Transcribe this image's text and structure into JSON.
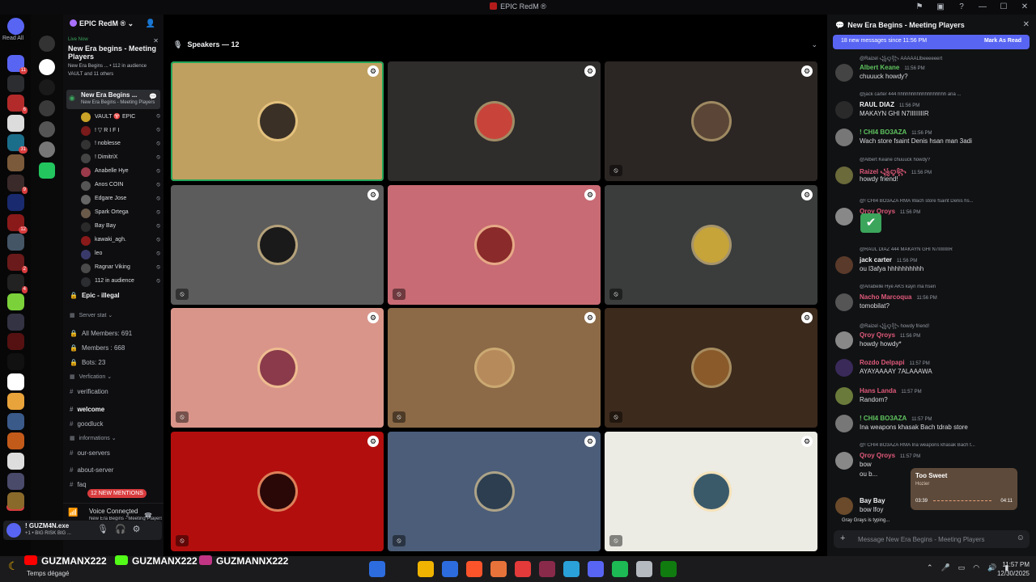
{
  "window": {
    "title": "EPIC RedM ®"
  },
  "rail": {
    "read_all": "Read All",
    "new_label": "NEW",
    "servers": [
      {
        "color": "#5865f2",
        "badge": "11"
      },
      {
        "color": "#2b2d31",
        "badge": ""
      },
      {
        "color": "#b32a2a",
        "badge": "6"
      },
      {
        "color": "#dcdcdc",
        "badge": ""
      },
      {
        "color": "#1b6e8a",
        "badge": "31"
      },
      {
        "color": "#7a5a3a",
        "badge": ""
      },
      {
        "color": "#3a2a2a",
        "badge": "9"
      },
      {
        "color": "#1a2a6e",
        "badge": ""
      },
      {
        "color": "#8a1a1a",
        "badge": "12"
      },
      {
        "color": "#445566",
        "badge": ""
      },
      {
        "color": "#6a1a1a",
        "badge": "2"
      },
      {
        "color": "#222",
        "badge": "4"
      },
      {
        "color": "#7bd13a",
        "badge": ""
      },
      {
        "color": "#333344",
        "badge": ""
      },
      {
        "color": "#551111",
        "badge": ""
      },
      {
        "color": "#111",
        "badge": ""
      },
      {
        "color": "#ffffff",
        "badge": ""
      },
      {
        "color": "#e8a33a",
        "badge": ""
      },
      {
        "color": "#3a5a8a",
        "badge": ""
      },
      {
        "color": "#c25a1a",
        "badge": ""
      },
      {
        "color": "#dddddd",
        "badge": ""
      },
      {
        "color": "#4a4a6a",
        "badge": ""
      },
      {
        "color": "#8a6a2a",
        "badge": ""
      }
    ]
  },
  "channels": {
    "server_name": "EPIC RedM ®",
    "live_now": {
      "label": "Live Now",
      "title": "New Era begins - Meeting Players",
      "sub": "New Era Begins ... • 112 in audience",
      "participants": "VAULT and 11 others"
    },
    "voice_channel": {
      "name": "New Era Begins ...",
      "sub": "New Era Begins - Meeting Players"
    },
    "voice_users": [
      {
        "name": "VAULT ♈ EPIC",
        "color": "#c9a227"
      },
      {
        "name": "! ▽ R I F I",
        "color": "#7a1a1a"
      },
      {
        "name": "! noblesse",
        "color": "#333"
      },
      {
        "name": "! DimitriX",
        "color": "#444"
      },
      {
        "name": "Anabelle Hye",
        "color": "#9a3a4a"
      },
      {
        "name": "Anos  COIN",
        "color": "#555"
      },
      {
        "name": "Edgare Jose",
        "color": "#666"
      },
      {
        "name": "Spark Ortega",
        "color": "#6a5a4a"
      },
      {
        "name": "Bay Bay",
        "color": "#2a2a2a"
      },
      {
        "name": "kawaki_agh.",
        "color": "#8a1a1a"
      },
      {
        "name": "leo",
        "color": "#3a3a6a"
      },
      {
        "name": "Ragnar Viking",
        "color": "#4a4a4a"
      },
      {
        "name": "112 in audience",
        "color": "#2b2d31"
      }
    ],
    "list": [
      {
        "name": "Epic - illegal",
        "hash": "🔒",
        "type": "bright"
      },
      {
        "name": "Server stat ⌄",
        "hash": "▦",
        "type": "cat"
      },
      {
        "name": "All Members: 691",
        "hash": "🔒",
        "type": ""
      },
      {
        "name": "Members : 668",
        "hash": "🔒",
        "type": ""
      },
      {
        "name": "Bots: 23",
        "hash": "🔒",
        "type": ""
      },
      {
        "name": "Verfication ⌄",
        "hash": "▦",
        "type": "cat"
      },
      {
        "name": "verification",
        "hash": "#",
        "type": ""
      },
      {
        "name": "welcome",
        "hash": "#",
        "type": "bright"
      },
      {
        "name": "goodluck",
        "hash": "#",
        "type": ""
      },
      {
        "name": "informations ⌄",
        "hash": "▦",
        "type": "cat"
      },
      {
        "name": "our-servers",
        "hash": "#",
        "type": ""
      },
      {
        "name": "about-server",
        "hash": "#",
        "type": ""
      },
      {
        "name": "faq",
        "hash": "#",
        "type": ""
      }
    ],
    "mentions": "12 NEW MENTIONS"
  },
  "voicebar": {
    "status": "Voice Connected",
    "channel": "New Era Begins - Meeting Players / EPIC..."
  },
  "user": {
    "name": "! GUZM4N.exe",
    "status": "+1 • BIG RISK BIG ..."
  },
  "stage": {
    "header": "Speakers — 12",
    "tiles": [
      {
        "bg": "#c0a060",
        "avatar": "#3a3026",
        "active": true,
        "muted": false
      },
      {
        "bg": "#2f2c2c",
        "avatar": "#c8443a",
        "active": false,
        "muted": false
      },
      {
        "bg": "#2b2624",
        "avatar": "#5a4536",
        "active": false,
        "muted": true
      },
      {
        "bg": "#5c5c5c",
        "avatar": "#1a1a1a",
        "active": false,
        "muted": true
      },
      {
        "bg": "#c86b74",
        "avatar": "#8a2a2a",
        "active": false,
        "muted": true
      },
      {
        "bg": "#3a3d3c",
        "avatar": "#c6a43a",
        "active": false,
        "muted": true
      },
      {
        "bg": "#d9958a",
        "avatar": "#8a3a4a",
        "active": false,
        "muted": true
      },
      {
        "bg": "#8c6a47",
        "avatar": "#b78a5c",
        "active": false,
        "muted": true
      },
      {
        "bg": "#3c2a1d",
        "avatar": "#8a5a2a",
        "active": false,
        "muted": true
      },
      {
        "bg": "#b30e0e",
        "avatar": "#2a0808",
        "active": false,
        "muted": true
      },
      {
        "bg": "#4b5d78",
        "avatar": "#2c3e50",
        "active": false,
        "muted": true
      },
      {
        "bg": "#ecebe4",
        "avatar": "#3a5a6a",
        "active": false,
        "muted": true
      }
    ]
  },
  "chat": {
    "title": "New Era Begins - Meeting Players",
    "unread": "18 new messages since 11:56 PM",
    "mark_read": "Mark As Read",
    "messages": [
      {
        "reply": "@Raizel ꧁ꨄ꧂ AAAAALlbeeeeeert",
        "name": "Albert Keane",
        "nc": "#5fc45f",
        "time": "11:56 PM",
        "text": "chuuuck howdy?",
        "ac": "#444"
      },
      {
        "reply": "@jack carter 444 hhhhhhhhhhhhhhhhhh ana ...",
        "name": "RAUL DIAZ",
        "nc": "#f2f3f5",
        "time": "11:56 PM",
        "text": "MAKAYN GHI N7IIIIIIIIR",
        "ac": "#2a2a2a"
      },
      {
        "reply": "",
        "name": "! CHI4 BO3AZA",
        "nc": "#5fc45f",
        "time": "11:56 PM",
        "text": "Wach store fsaint Denis hsan man 3adi",
        "ac": "#777"
      },
      {
        "reply": "@Albert Keane chuuuck howdy?",
        "name": "Raizel ꧁ꨄ꧂",
        "nc": "#e05a7a",
        "time": "11:56 PM",
        "text": "howdy friend!",
        "ac": "#6a6a3a"
      },
      {
        "reply": "@! CHI4 BO3AZA RMA Wach store fsaint Denis hs...",
        "name": "Qroy Qroys",
        "nc": "#e05a7a",
        "time": "11:56 PM",
        "text": "",
        "ac": "#888"
      },
      {
        "reply": "@RAUL DIAZ 444 MAKAYN GHI N7IIIIIIIIR",
        "name": "jack carter",
        "nc": "#f2f3f5",
        "time": "11:56 PM",
        "text": "ou l3afya hhhhhhhhhh",
        "ac": "#5a3a2a"
      },
      {
        "reply": "@Anabelle Hye AKS kayn ma hsen",
        "name": "Nacho Marcoqua",
        "nc": "#e05a7a",
        "time": "11:56 PM",
        "text": "tomobilat?",
        "ac": "#555"
      },
      {
        "reply": "@Raizel ꧁ꨄ꧂ howdy friend!",
        "name": "Qroy Qroys",
        "nc": "#e05a7a",
        "time": "11:56 PM",
        "text": "howdy howdy*",
        "ac": "#888"
      },
      {
        "reply": "",
        "name": "Rozdo Delpapi",
        "nc": "#e05a7a",
        "time": "11:57 PM",
        "text": "AYAYAAAAY 7ALAAAWA",
        "ac": "#3a2a5a"
      },
      {
        "reply": "",
        "name": "Hans Landa",
        "nc": "#e05a7a",
        "time": "11:57 PM",
        "text": "Random?",
        "ac": "#6a7a3a"
      },
      {
        "reply": "",
        "name": "! CHI4 BO3AZA",
        "nc": "#5fc45f",
        "time": "11:57 PM",
        "text": "Ina weapons khasak Bach tdrab store",
        "ac": "#777"
      },
      {
        "reply": "@! CHI4 BO3AZA RMA Ina weapons khasak Bach t...",
        "name": "Qroy Qroys",
        "nc": "#e05a7a",
        "time": "11:57 PM",
        "text": "bow",
        "ac": "#888"
      },
      {
        "reply": "",
        "name": "Bay Bay",
        "nc": "#f2f3f5",
        "time": "",
        "text": "bow lfoy",
        "ac": "#6a4a2a"
      }
    ],
    "extra_line": "ou b...",
    "typing": "Gray Grays is typing...",
    "composer_placeholder": "Message New Era Begins - Meeting Players"
  },
  "now_playing": {
    "title": "Too Sweet",
    "artist": "Hozier",
    "current": "03:39",
    "duration": "04:11"
  },
  "taskbar": {
    "weather": "Temps dégagé",
    "streams": [
      {
        "label": "GUZMANX222",
        "color": "#ff0000"
      },
      {
        "label": "GUZMANX222",
        "color": "#53fc18"
      },
      {
        "label": "GUZMANNX222",
        "color": "#c13584"
      }
    ],
    "apps": [
      "#2d6cdf",
      "#1b1b1d",
      "#f0b400",
      "#2d6cdf",
      "#fb542b",
      "#e8733a",
      "#e43a3a",
      "#8a2a4a",
      "#2aa1d8",
      "#5865f2",
      "#1db954",
      "#b5bac1",
      "#107c10"
    ],
    "time": "11:57 PM",
    "date": "12/30/2025"
  }
}
